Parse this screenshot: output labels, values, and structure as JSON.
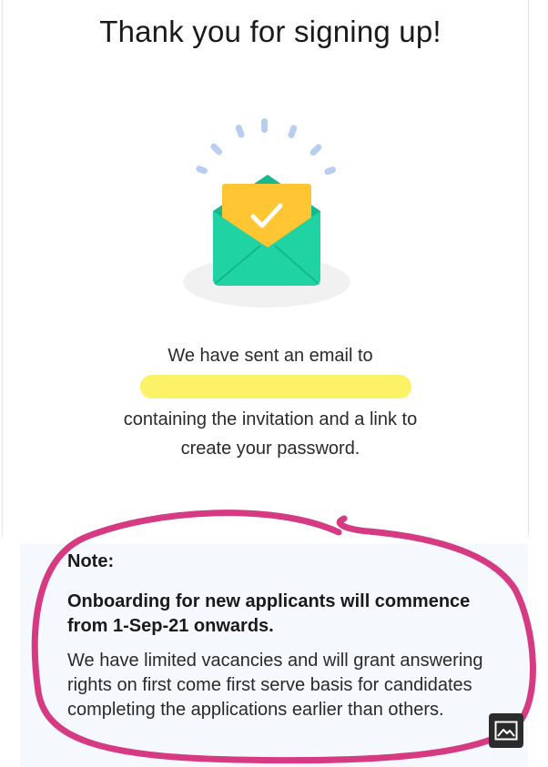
{
  "header": {
    "title": "Thank you for signing up!"
  },
  "message": {
    "line1": "We have sent an email to",
    "line3": "containing the invitation and a link to",
    "line4": "create your password."
  },
  "note": {
    "label": "Note:",
    "headline": "Onboarding for new applicants will commence from 1-Sep-21 onwards.",
    "body": "We have limited vacancies and will grant answering rights on first come first serve basis for candidates completing the applications earlier than others."
  },
  "colors": {
    "envelope": "#1fd3a3",
    "letter": "#ffc533",
    "sparkle": "#b7cef0",
    "highlight": "#fbf15a",
    "annotation": "#d63a82"
  },
  "icons": {
    "illustration": "envelope-check-icon",
    "corner_button": "image-icon"
  }
}
